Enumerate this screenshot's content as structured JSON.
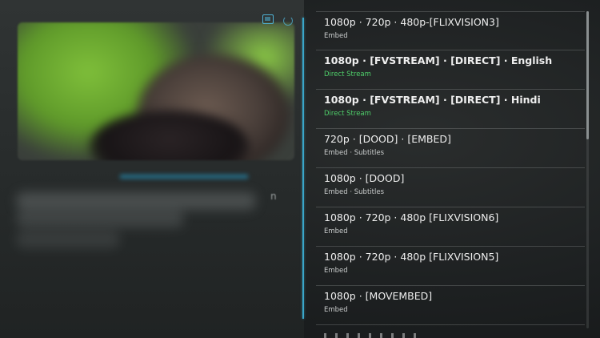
{
  "colors": {
    "accent": "#3aa6c9",
    "direct_stream": "#4fcf6a",
    "text_primary": "#eeeeee",
    "text_secondary": "#c9cccc"
  },
  "header": {
    "icons": [
      "tv-icon",
      "loading-icon"
    ]
  },
  "sources": [
    {
      "title": "1080p · 720p · 480p-[FLIXVISION3]",
      "subtitle": "Embed",
      "type": "embed"
    },
    {
      "title": "1080p · [FVSTREAM] · [DIRECT] · English",
      "subtitle": "Direct Stream",
      "type": "direct"
    },
    {
      "title": "1080p · [FVSTREAM] · [DIRECT] · Hindi",
      "subtitle": "Direct Stream",
      "type": "direct"
    },
    {
      "title": "720p · [DOOD] · [EMBED]",
      "subtitle": "Embed · Subtitles",
      "type": "embed"
    },
    {
      "title": "1080p · [DOOD]",
      "subtitle": "Embed · Subtitles",
      "type": "embed"
    },
    {
      "title": "1080p · 720p · 480p [FLIXVISION6]",
      "subtitle": "Embed",
      "type": "embed"
    },
    {
      "title": "1080p · 720p · 480p [FLIXVISION5]",
      "subtitle": "Embed",
      "type": "embed"
    },
    {
      "title": "1080p · [MOVEMBED]",
      "subtitle": "Embed",
      "type": "embed"
    }
  ]
}
